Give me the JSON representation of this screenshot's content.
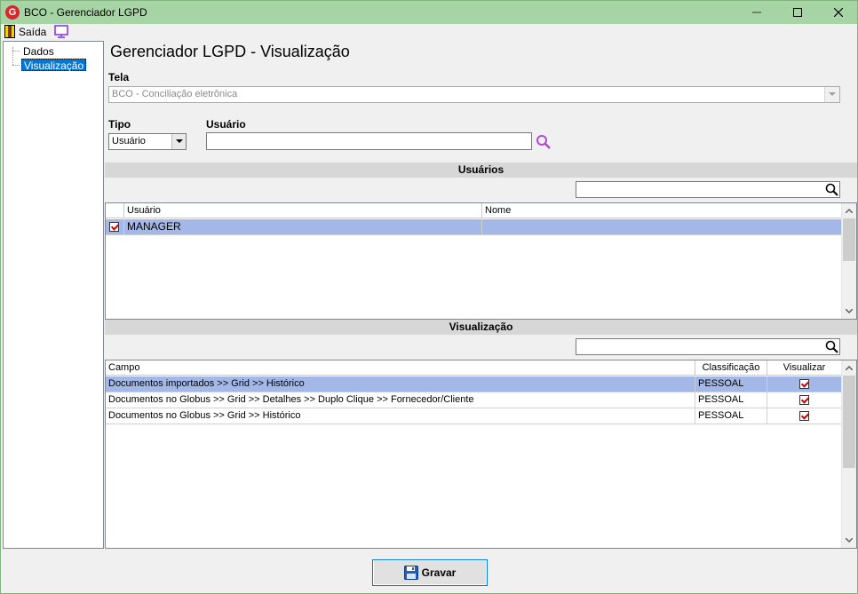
{
  "window": {
    "title": "BCO - Gerenciador LGPD",
    "app_icon_letter": "G"
  },
  "menu": {
    "exit_label": "Saída"
  },
  "tree": {
    "items": [
      {
        "label": "Dados"
      },
      {
        "label": "Visualização"
      }
    ]
  },
  "page": {
    "title": "Gerenciador LGPD - Visualização"
  },
  "form": {
    "tela_label": "Tela",
    "tela_value": "BCO - Conciliação eletrônica",
    "tipo_label": "Tipo",
    "tipo_value": "Usuário",
    "usuario_label": "Usuário",
    "usuario_value": ""
  },
  "users_section": {
    "title": "Usuários",
    "search_value": "",
    "columns": [
      "Usuário",
      "Nome"
    ],
    "rows": [
      {
        "usuario": "MANAGER",
        "nome": "",
        "checked": true
      }
    ]
  },
  "view_section": {
    "title": "Visualização",
    "search_value": "",
    "columns": [
      "Campo",
      "Classificação",
      "Visualizar"
    ],
    "rows": [
      {
        "campo": "Documentos importados >> Grid >> Histórico",
        "classificacao": "PESSOAL",
        "visualizar": true
      },
      {
        "campo": "Documentos no Globus >> Grid >> Detalhes >> Duplo Clique >> Fornecedor/Cliente",
        "classificacao": "PESSOAL",
        "visualizar": true
      },
      {
        "campo": "Documentos no Globus >> Grid >> Histórico",
        "classificacao": "PESSOAL",
        "visualizar": true
      }
    ]
  },
  "footer": {
    "save_label": "Gravar"
  },
  "colors": {
    "selection": "#a4b8e8",
    "titlebar": "#a7d4a4",
    "accent": "#0078d7"
  }
}
